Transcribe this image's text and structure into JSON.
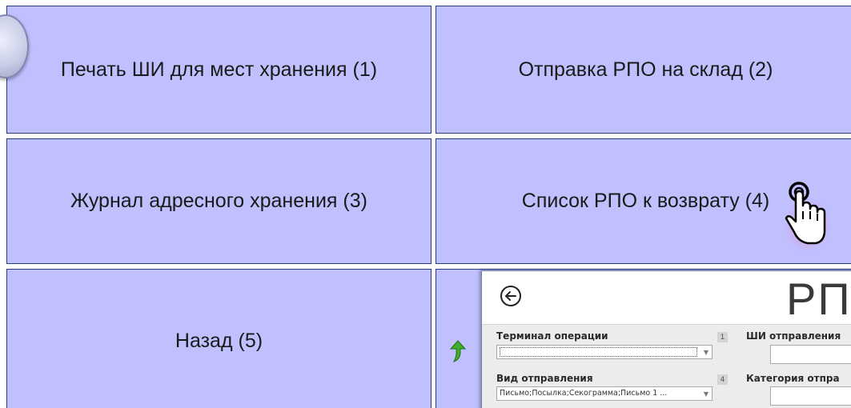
{
  "menu": {
    "tiles": [
      {
        "label": "Печать ШИ для мест хранения (1)"
      },
      {
        "label": "Отправка РПО на склад (2)"
      },
      {
        "label": "Журнал адресного хранения (3)"
      },
      {
        "label": "Список РПО к возврату (4)"
      },
      {
        "label": "Назад (5)"
      },
      {
        "label": ""
      }
    ]
  },
  "overlay": {
    "title": "РПС",
    "fields": {
      "terminal_label": "Терминал операции",
      "terminal_num": "1",
      "terminal_value": "",
      "shi_label": "ШИ отправления",
      "type_label": "Вид отправления",
      "type_num": "4",
      "type_value": "Письмо;Посылка;Секограмма;Письмо 1 ...",
      "category_label": "Категория отпра"
    }
  },
  "colors": {
    "tile_bg": "#c0c0ff",
    "tile_border": "#243a8a",
    "cursor_hand": "#cc66aa",
    "arrow_green": "#3fae2a"
  },
  "icons": {
    "cursor": "pointing-hand-icon",
    "back": "back-arrow-icon",
    "return": "green-arrow-icon"
  }
}
